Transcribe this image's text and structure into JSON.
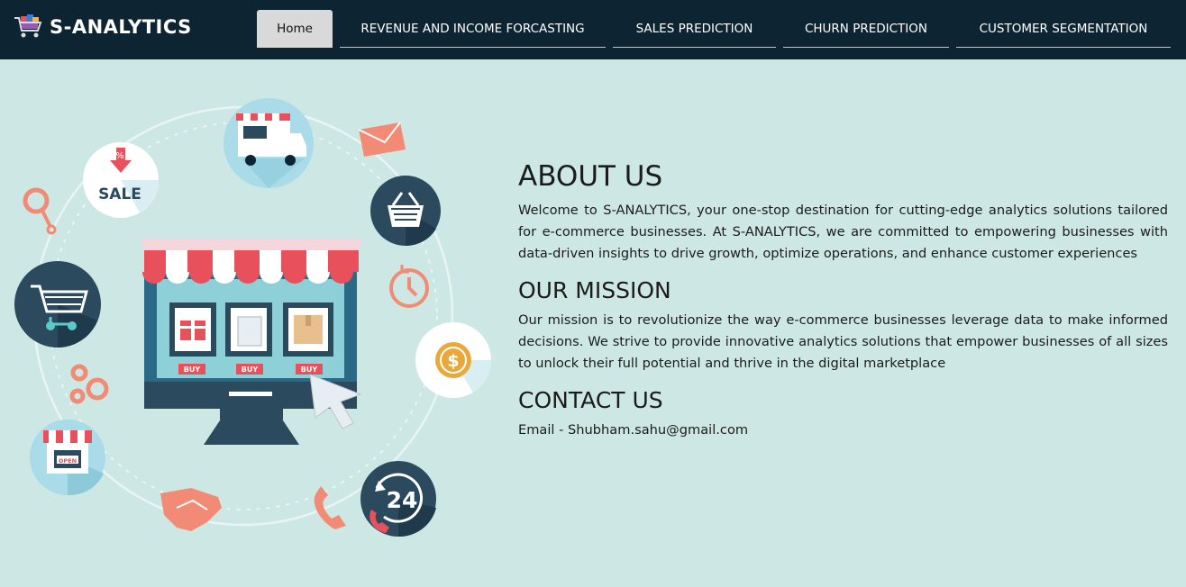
{
  "brand": {
    "name": "S-ANALYTICS",
    "logo_icon": "shopping-cart-logo-icon"
  },
  "nav": {
    "tabs": [
      {
        "label": "Home",
        "active": true
      },
      {
        "label": "REVENUE AND INCOME FORCASTING",
        "active": false
      },
      {
        "label": "SALES PREDICTION",
        "active": false
      },
      {
        "label": "CHURN PREDICTION",
        "active": false
      },
      {
        "label": "CUSTOMER SEGMENTATION",
        "active": false
      }
    ]
  },
  "illustration": {
    "sale_text": "SALE",
    "percent_text": "%",
    "buy_label": "BUY",
    "open_label": "OPEN",
    "hours_text": "24",
    "dollar_text": "$"
  },
  "about": {
    "title": "ABOUT US",
    "text": "Welcome to S-ANALYTICS, your one-stop destination for cutting-edge analytics solutions tailored for e-commerce businesses. At S-ANALYTICS, we are committed to empowering businesses with data-driven insights to drive growth, optimize operations, and enhance customer experiences"
  },
  "mission": {
    "title": "OUR MISSION",
    "text": "Our mission is to revolutionize the way e-commerce businesses leverage data to make informed decisions. We strive to provide innovative analytics solutions that empower businesses of all sizes to unlock their full potential and thrive in the digital marketplace"
  },
  "contact": {
    "title": "CONTACT US",
    "email": "Email - Shubham.sahu@gmail.com"
  },
  "colors": {
    "navbar_bg": "#0d2533",
    "page_bg": "#cde8e4",
    "accent_red": "#e8505b",
    "dark_teal": "#2b4a5e",
    "salmon": "#f28b76"
  }
}
